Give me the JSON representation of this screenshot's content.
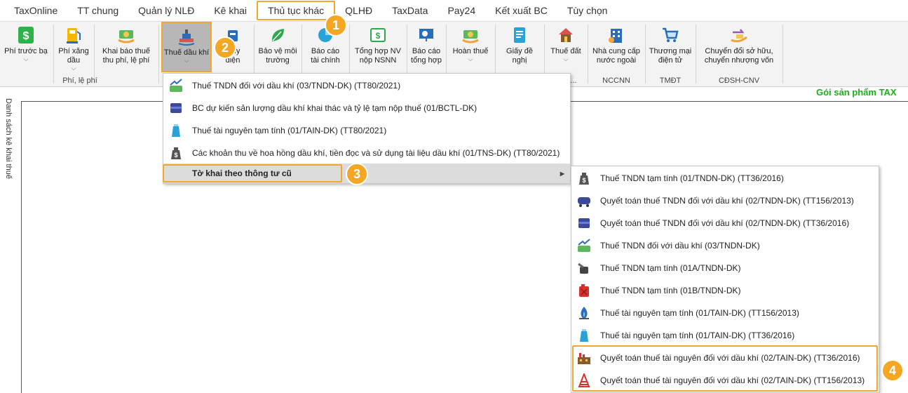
{
  "menubar": [
    "TaxOnline",
    "TT chung",
    "Quản lý NLĐ",
    "Kê khai",
    "Thủ tục khác",
    "QLHĐ",
    "TaxData",
    "Pay24",
    "Kết xuất BC",
    "Tùy chọn"
  ],
  "ribbon": {
    "phi_truoc_ba": [
      "Phí trước bạ",
      ""
    ],
    "phi_xang_dau": [
      "Phí xăng",
      "dầu"
    ],
    "khai_bao_thue": [
      "Khai báo thuế",
      "thu phí, lệ phí"
    ],
    "thue_dau_khi": [
      "Thuế dầu khí",
      ""
    ],
    "thuy_dien": [
      "...ủy",
      "điện"
    ],
    "bao_ve_moi_truong": [
      "Bảo vệ môi",
      "trường"
    ],
    "bao_cao_tai_chinh": [
      "Báo cáo",
      "tài chính"
    ],
    "tong_hop_nv": [
      "Tổng hợp NV",
      "nộp NSNN"
    ],
    "bao_cao_tong_hop": [
      "Báo cáo",
      "tổng hợp"
    ],
    "hoan_thue": [
      "Hoàn thuế",
      ""
    ],
    "giay_de_nghi": [
      "Giấy đề",
      "nghị"
    ],
    "thue_dat": [
      "Thuế đất",
      ""
    ],
    "nha_cung_cap": [
      "Nhà cung cấp",
      "nước ngoài"
    ],
    "thuong_mai": [
      "Thương mại",
      "điện tử"
    ],
    "chuyen_doi": [
      "Chuyển đổi sở hữu,",
      "chuyển nhượng vốn"
    ],
    "groups": {
      "phi": "Phí, lệ phí",
      "dots": "...",
      "nccnn": "NCCNN",
      "tmdt": "TMĐT",
      "cdsh": "CĐSH-CNV"
    }
  },
  "sidebar_label": "Danh sách kê khai thuế",
  "product_label": "Gói sản phẩm TAX",
  "menu1": [
    {
      "icon": "chart-up-icon",
      "label": "Thuế TNDN đối với dầu khí (03/TNDN-DK) (TT80/2021)"
    },
    {
      "icon": "oil-tanker-icon",
      "label": "BC dự kiến sản lượng dầu khí  khai thác và tỷ lệ tạm nộp thuế (01/BCTL-DK)"
    },
    {
      "icon": "factory-icon",
      "label": "Thuế tài nguyên tạm tính (01/TAIN-DK) (TT80/2021)"
    },
    {
      "icon": "money-bag-icon",
      "label": "Các khoản thu về hoa hồng dầu khí, tiền đọc và sử dụng tài liệu dầu khí (01/TNS-DK) (TT80/2021)"
    },
    {
      "icon": "",
      "label": "Tờ khai theo thông tư cũ"
    }
  ],
  "menu2": [
    {
      "icon": "money-bag-icon",
      "label": "Thuế TNDN tạm tính (01/TNDN-DK) (TT36/2016)"
    },
    {
      "icon": "oil-truck-icon",
      "label": "Quyết toán thuế TNDN đối với dầu khí (02/TNDN-DK) (TT156/2013)"
    },
    {
      "icon": "oil-tanker-icon",
      "label": "Quyết toán thuế TNDN đối với dầu khí (02/TNDN-DK) (TT36/2016)"
    },
    {
      "icon": "chart-up-icon",
      "label": "Thuế TNDN đối với dầu khí (03/TNDN-DK)"
    },
    {
      "icon": "oil-can-icon",
      "label": "Thuế TNDN tạm tính (01A/TNDN-DK)"
    },
    {
      "icon": "jerrycan-icon",
      "label": "Thuế TNDN tạm tính (01B/TNDN-DK)"
    },
    {
      "icon": "gas-flame-icon",
      "label": "Thuế tài nguyên tạm tính (01/TAIN-DK) (TT156/2013)"
    },
    {
      "icon": "factory-icon",
      "label": "Thuế tài nguyên tạm tính (01/TAIN-DK) (TT36/2016)"
    },
    {
      "icon": "refinery-icon",
      "label": "Quyết toán thuế tài nguyên đối với dầu khí (02/TAIN-DK) (TT36/2016)"
    },
    {
      "icon": "oil-rig-icon",
      "label": "Quyết toán thuế tài nguyên đối với dầu khí (02/TAIN-DK) (TT156/2013)"
    }
  ],
  "badges": [
    "1",
    "2",
    "3",
    "4"
  ],
  "colors": {
    "highlight": "#f0a92e",
    "badge": "#f5a623",
    "product": "#19b019"
  }
}
